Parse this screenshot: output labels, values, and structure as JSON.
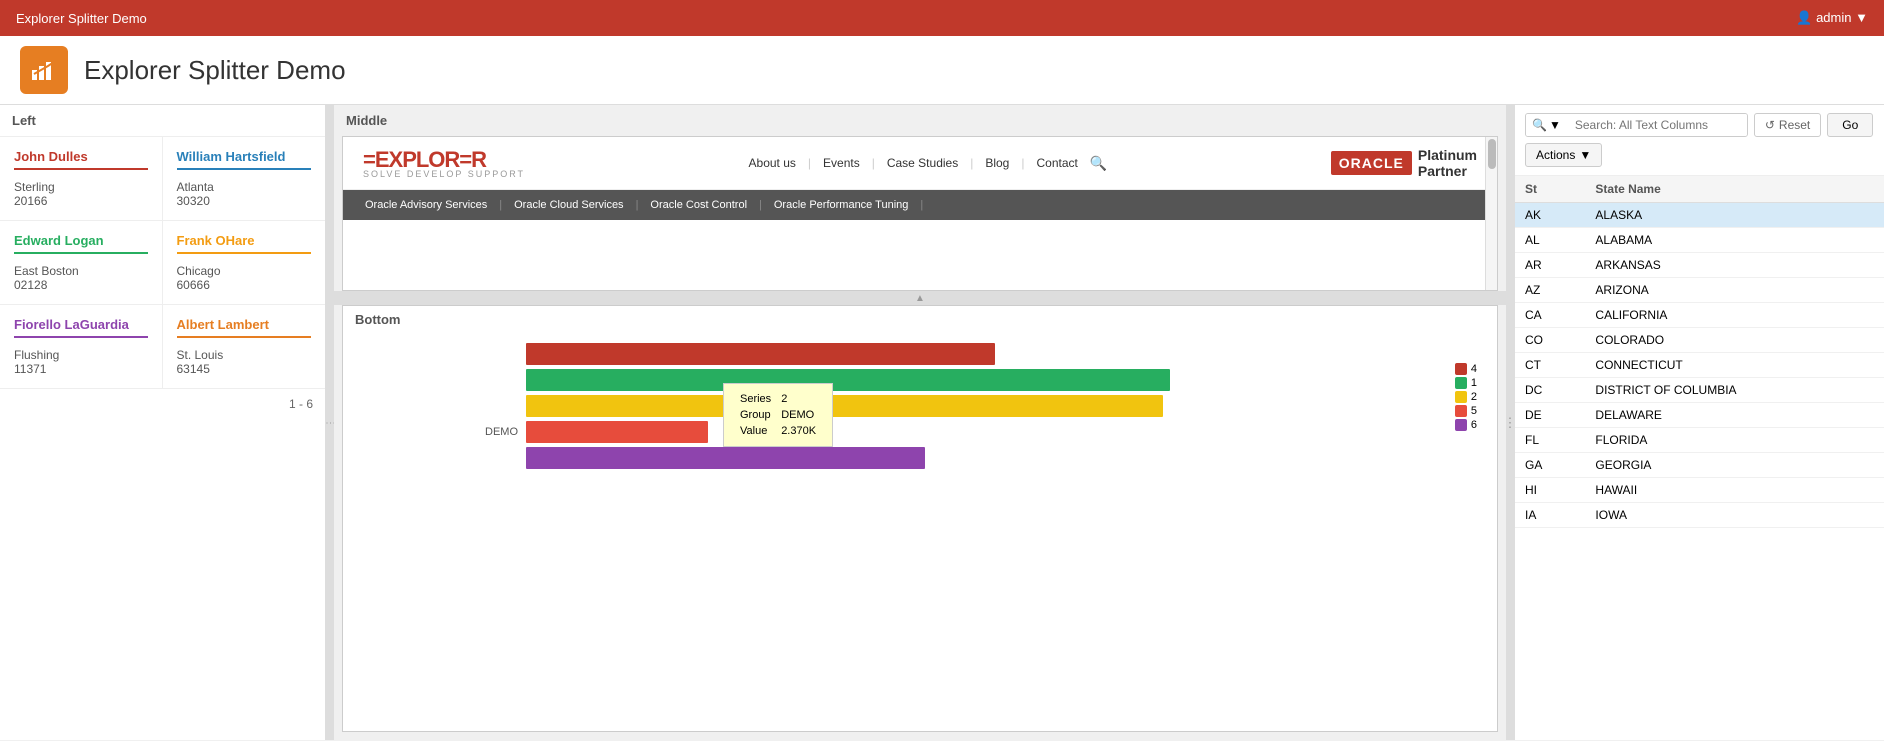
{
  "topbar": {
    "title": "Explorer Splitter Demo",
    "user": "admin",
    "user_icon": "👤"
  },
  "header": {
    "app_title": "Explorer Splitter Demo",
    "app_icon": "📊"
  },
  "left": {
    "label": "Left",
    "cards": [
      {
        "name": "John Dulles",
        "city": "Sterling",
        "zip": "20166",
        "color": "#c0392b"
      },
      {
        "name": "William Hartsfield",
        "city": "Atlanta",
        "zip": "30320",
        "color": "#2980b9"
      },
      {
        "name": "Edward Logan",
        "city": "East Boston",
        "zip": "02128",
        "color": "#27ae60"
      },
      {
        "name": "Frank OHare",
        "city": "Chicago",
        "zip": "60666",
        "color": "#f39c12"
      },
      {
        "name": "Fiorello LaGuardia",
        "city": "Flushing",
        "zip": "11371",
        "color": "#8e44ad"
      },
      {
        "name": "Albert Lambert",
        "city": "St. Louis",
        "zip": "63145",
        "color": "#e67e22"
      }
    ],
    "pagination": "1 - 6"
  },
  "middle": {
    "label": "Middle",
    "site": {
      "logo": "=EXPLOR=R",
      "logo_sub": "SOLVE  DEVELOP  SUPPORT",
      "nav_links": [
        "About us",
        "Events",
        "Case Studies",
        "Blog",
        "Contact"
      ],
      "oracle_label": "ORACLE",
      "oracle_partner": "Platinum Partner",
      "bottom_nav": [
        "Oracle Advisory Services",
        "Oracle Cloud Services",
        "Oracle Cost Control",
        "Oracle Performance Tuning"
      ]
    },
    "bottom": {
      "label": "Bottom",
      "chart": {
        "group": "DEMO",
        "bars": [
          {
            "label": "",
            "color": "#c0392b",
            "width_pct": 67,
            "series": 4
          },
          {
            "label": "",
            "color": "#27ae60",
            "width_pct": 92,
            "series": 1
          },
          {
            "label": "",
            "color": "#f1c40f",
            "width_pct": 91,
            "series": 2
          },
          {
            "label": "DEMO",
            "color": "#e74c3c",
            "width_pct": 26,
            "series": 5
          },
          {
            "label": "",
            "color": "#8e44ad",
            "width_pct": 57,
            "series": 6
          }
        ],
        "tooltip": {
          "series": "2",
          "group": "DEMO",
          "value": "2.370K"
        },
        "legend": [
          {
            "label": "4",
            "color": "#c0392b"
          },
          {
            "label": "1",
            "color": "#27ae60"
          },
          {
            "label": "2",
            "color": "#f1c40f"
          },
          {
            "label": "5",
            "color": "#e74c3c"
          },
          {
            "label": "6",
            "color": "#8e44ad"
          }
        ]
      }
    }
  },
  "right": {
    "search_placeholder": "Search: All Text Columns",
    "reset_label": "Reset",
    "go_label": "Go",
    "actions_label": "Actions",
    "table": {
      "cols": [
        "St",
        "State Name"
      ],
      "rows": [
        {
          "st": "AK",
          "name": "ALASKA",
          "selected": true
        },
        {
          "st": "AL",
          "name": "ALABAMA"
        },
        {
          "st": "AR",
          "name": "ARKANSAS"
        },
        {
          "st": "AZ",
          "name": "ARIZONA"
        },
        {
          "st": "CA",
          "name": "CALIFORNIA"
        },
        {
          "st": "CO",
          "name": "COLORADO"
        },
        {
          "st": "CT",
          "name": "CONNECTICUT"
        },
        {
          "st": "DC",
          "name": "DISTRICT OF COLUMBIA"
        },
        {
          "st": "DE",
          "name": "DELAWARE"
        },
        {
          "st": "FL",
          "name": "FLORIDA"
        },
        {
          "st": "GA",
          "name": "GEORGIA"
        },
        {
          "st": "HI",
          "name": "HAWAII"
        },
        {
          "st": "IA",
          "name": "IOWA"
        }
      ]
    }
  }
}
